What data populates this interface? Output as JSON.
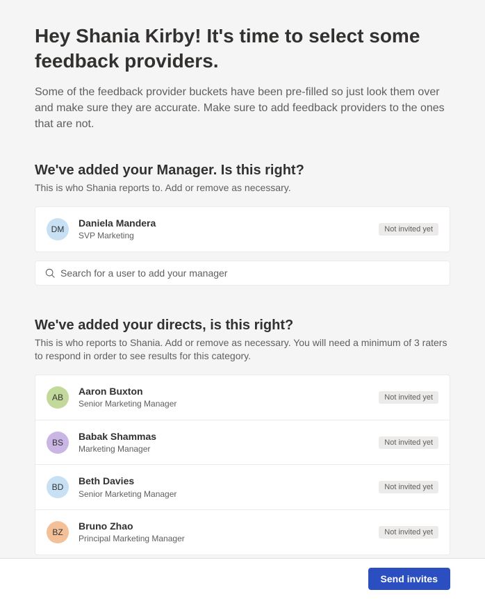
{
  "header": {
    "title": "Hey Shania Kirby! It's time to select some feedback providers.",
    "subtitle": "Some of the feedback provider buckets have been pre-filled so just look them over and make sure they are accurate. Make sure to add feedback providers to the ones that are not."
  },
  "manager_section": {
    "title": "We've added your Manager. Is this right?",
    "subtitle": "This is who Shania reports to. Add or remove as necessary.",
    "search_placeholder": "Search for a user to add your manager",
    "people": [
      {
        "initials": "DM",
        "name": "Daniela Mandera",
        "role": "SVP Marketing",
        "status": "Not invited yet",
        "avatar_color": "#c7e0f4"
      }
    ]
  },
  "directs_section": {
    "title": "We've added your directs, is this right?",
    "subtitle": "This is who reports to Shania. Add or remove as necessary. You will need a minimum of 3 raters to respond in order to see results for this category.",
    "people": [
      {
        "initials": "AB",
        "name": "Aaron Buxton",
        "role": "Senior Marketing Manager",
        "status": "Not invited yet",
        "avatar_color": "#c3d89b"
      },
      {
        "initials": "BS",
        "name": "Babak Shammas",
        "role": "Marketing Manager",
        "status": "Not invited yet",
        "avatar_color": "#c9b6e4"
      },
      {
        "initials": "BD",
        "name": "Beth Davies",
        "role": "Senior Marketing Manager",
        "status": "Not invited yet",
        "avatar_color": "#c7e0f4"
      },
      {
        "initials": "BZ",
        "name": "Bruno Zhao",
        "role": "Principal Marketing Manager",
        "status": "Not invited yet",
        "avatar_color": "#f4c098"
      }
    ]
  },
  "footer": {
    "send_label": "Send invites"
  }
}
